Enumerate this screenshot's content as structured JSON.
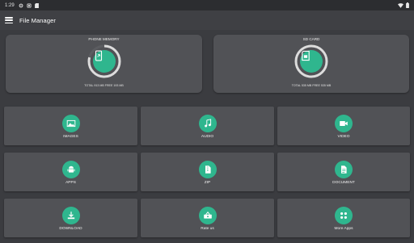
{
  "status_bar": {
    "time": "1:29"
  },
  "app_bar": {
    "title": "File Manager"
  },
  "storage": {
    "phone": {
      "title": "PHONE MEMORY",
      "info": "TOTAL 913 MB FREE 193 MB",
      "used_fraction": 0.79
    },
    "sd": {
      "title": "SD CARD",
      "info": "TOTAL 535 MB FREE 535 MB",
      "used_fraction": 0.0
    }
  },
  "categories": [
    {
      "label": "IMAGES",
      "icon": "image-icon"
    },
    {
      "label": "AUDIO",
      "icon": "music-note-icon"
    },
    {
      "label": "VIDEO",
      "icon": "video-camera-icon"
    },
    {
      "label": "APPS",
      "icon": "android-icon"
    },
    {
      "label": "ZIP",
      "icon": "zip-file-icon"
    },
    {
      "label": "DOCUMENT",
      "icon": "document-icon"
    },
    {
      "label": "DOWNLOAD",
      "icon": "download-icon"
    },
    {
      "label": "Rate us",
      "icon": "rate-icon"
    },
    {
      "label": "More Apps",
      "icon": "grid-apps-icon"
    }
  ],
  "colors": {
    "accent": "#2fb68e",
    "card": "#515256",
    "background": "#3b3c40",
    "ring_track": "#dcdcdc"
  }
}
